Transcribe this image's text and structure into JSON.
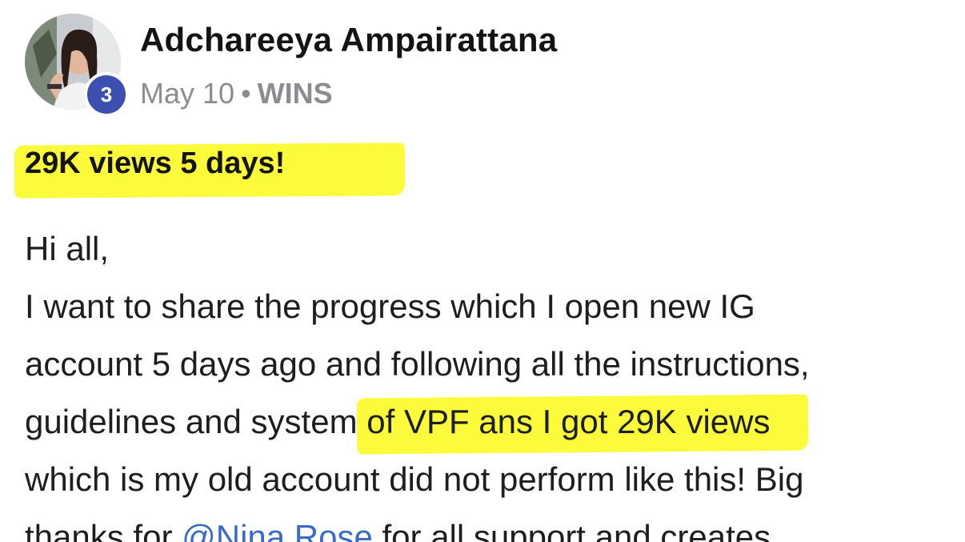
{
  "post": {
    "author": {
      "name": "Adchareeya Ampairattana",
      "avatar_icon": "profile-photo",
      "level": "3",
      "level_color": "#3d4fb0"
    },
    "meta": {
      "date": "May 10",
      "separator": "•",
      "category": "WINS"
    },
    "title": "29K views 5 days!",
    "highlight_color": "#fbfb3c",
    "body": {
      "line1": "Hi all,",
      "line2": "I want to share the progress which I open new IG",
      "line3": "account 5 days ago and following all the instructions,",
      "line4_plain": "guidelines and system ",
      "line4_highlight": "of VPF ans I got 29K views",
      "line5": "which is my old account did not perform like this! Big",
      "line6_before": "thanks for ",
      "mention": "@Nina Rose",
      "line6_after": " for all support and creates",
      "mention_color": "#3b6bc8"
    }
  }
}
